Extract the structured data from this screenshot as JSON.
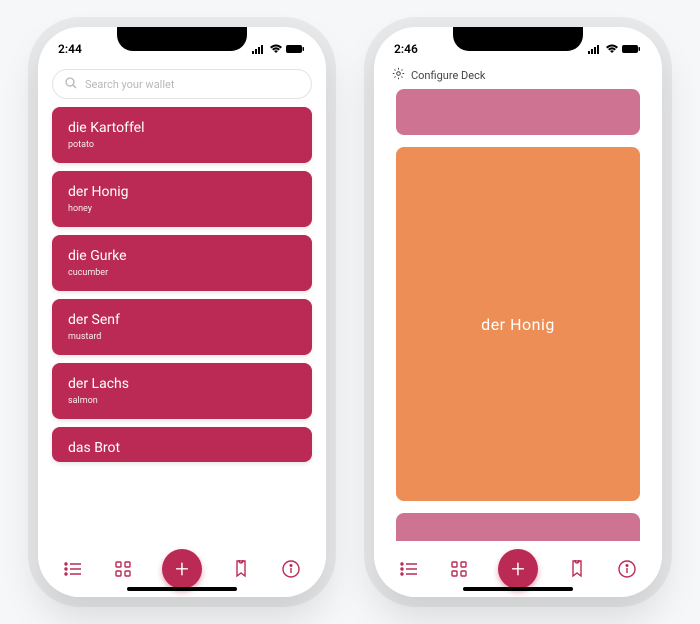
{
  "colors": {
    "accent": "#bb2a55",
    "deck_peek": "#cf7393",
    "deck_main": "#ec8e55"
  },
  "screen1": {
    "time": "2:44",
    "search_placeholder": "Search your wallet",
    "cards": [
      {
        "title": "die Kartoffel",
        "sub": "potato"
      },
      {
        "title": "der Honig",
        "sub": "honey"
      },
      {
        "title": "die Gurke",
        "sub": "cucumber"
      },
      {
        "title": "der Senf",
        "sub": "mustard"
      },
      {
        "title": "der Lachs",
        "sub": "salmon"
      },
      {
        "title": "das Brot",
        "sub": ""
      }
    ]
  },
  "screen2": {
    "time": "2:46",
    "configure_label": "Configure Deck",
    "current_card": "der  Honig"
  },
  "tabbar": {
    "icons": [
      "list-icon",
      "grid-icon",
      "add-icon",
      "bookmark-icon",
      "info-icon"
    ],
    "add_label": "+"
  }
}
